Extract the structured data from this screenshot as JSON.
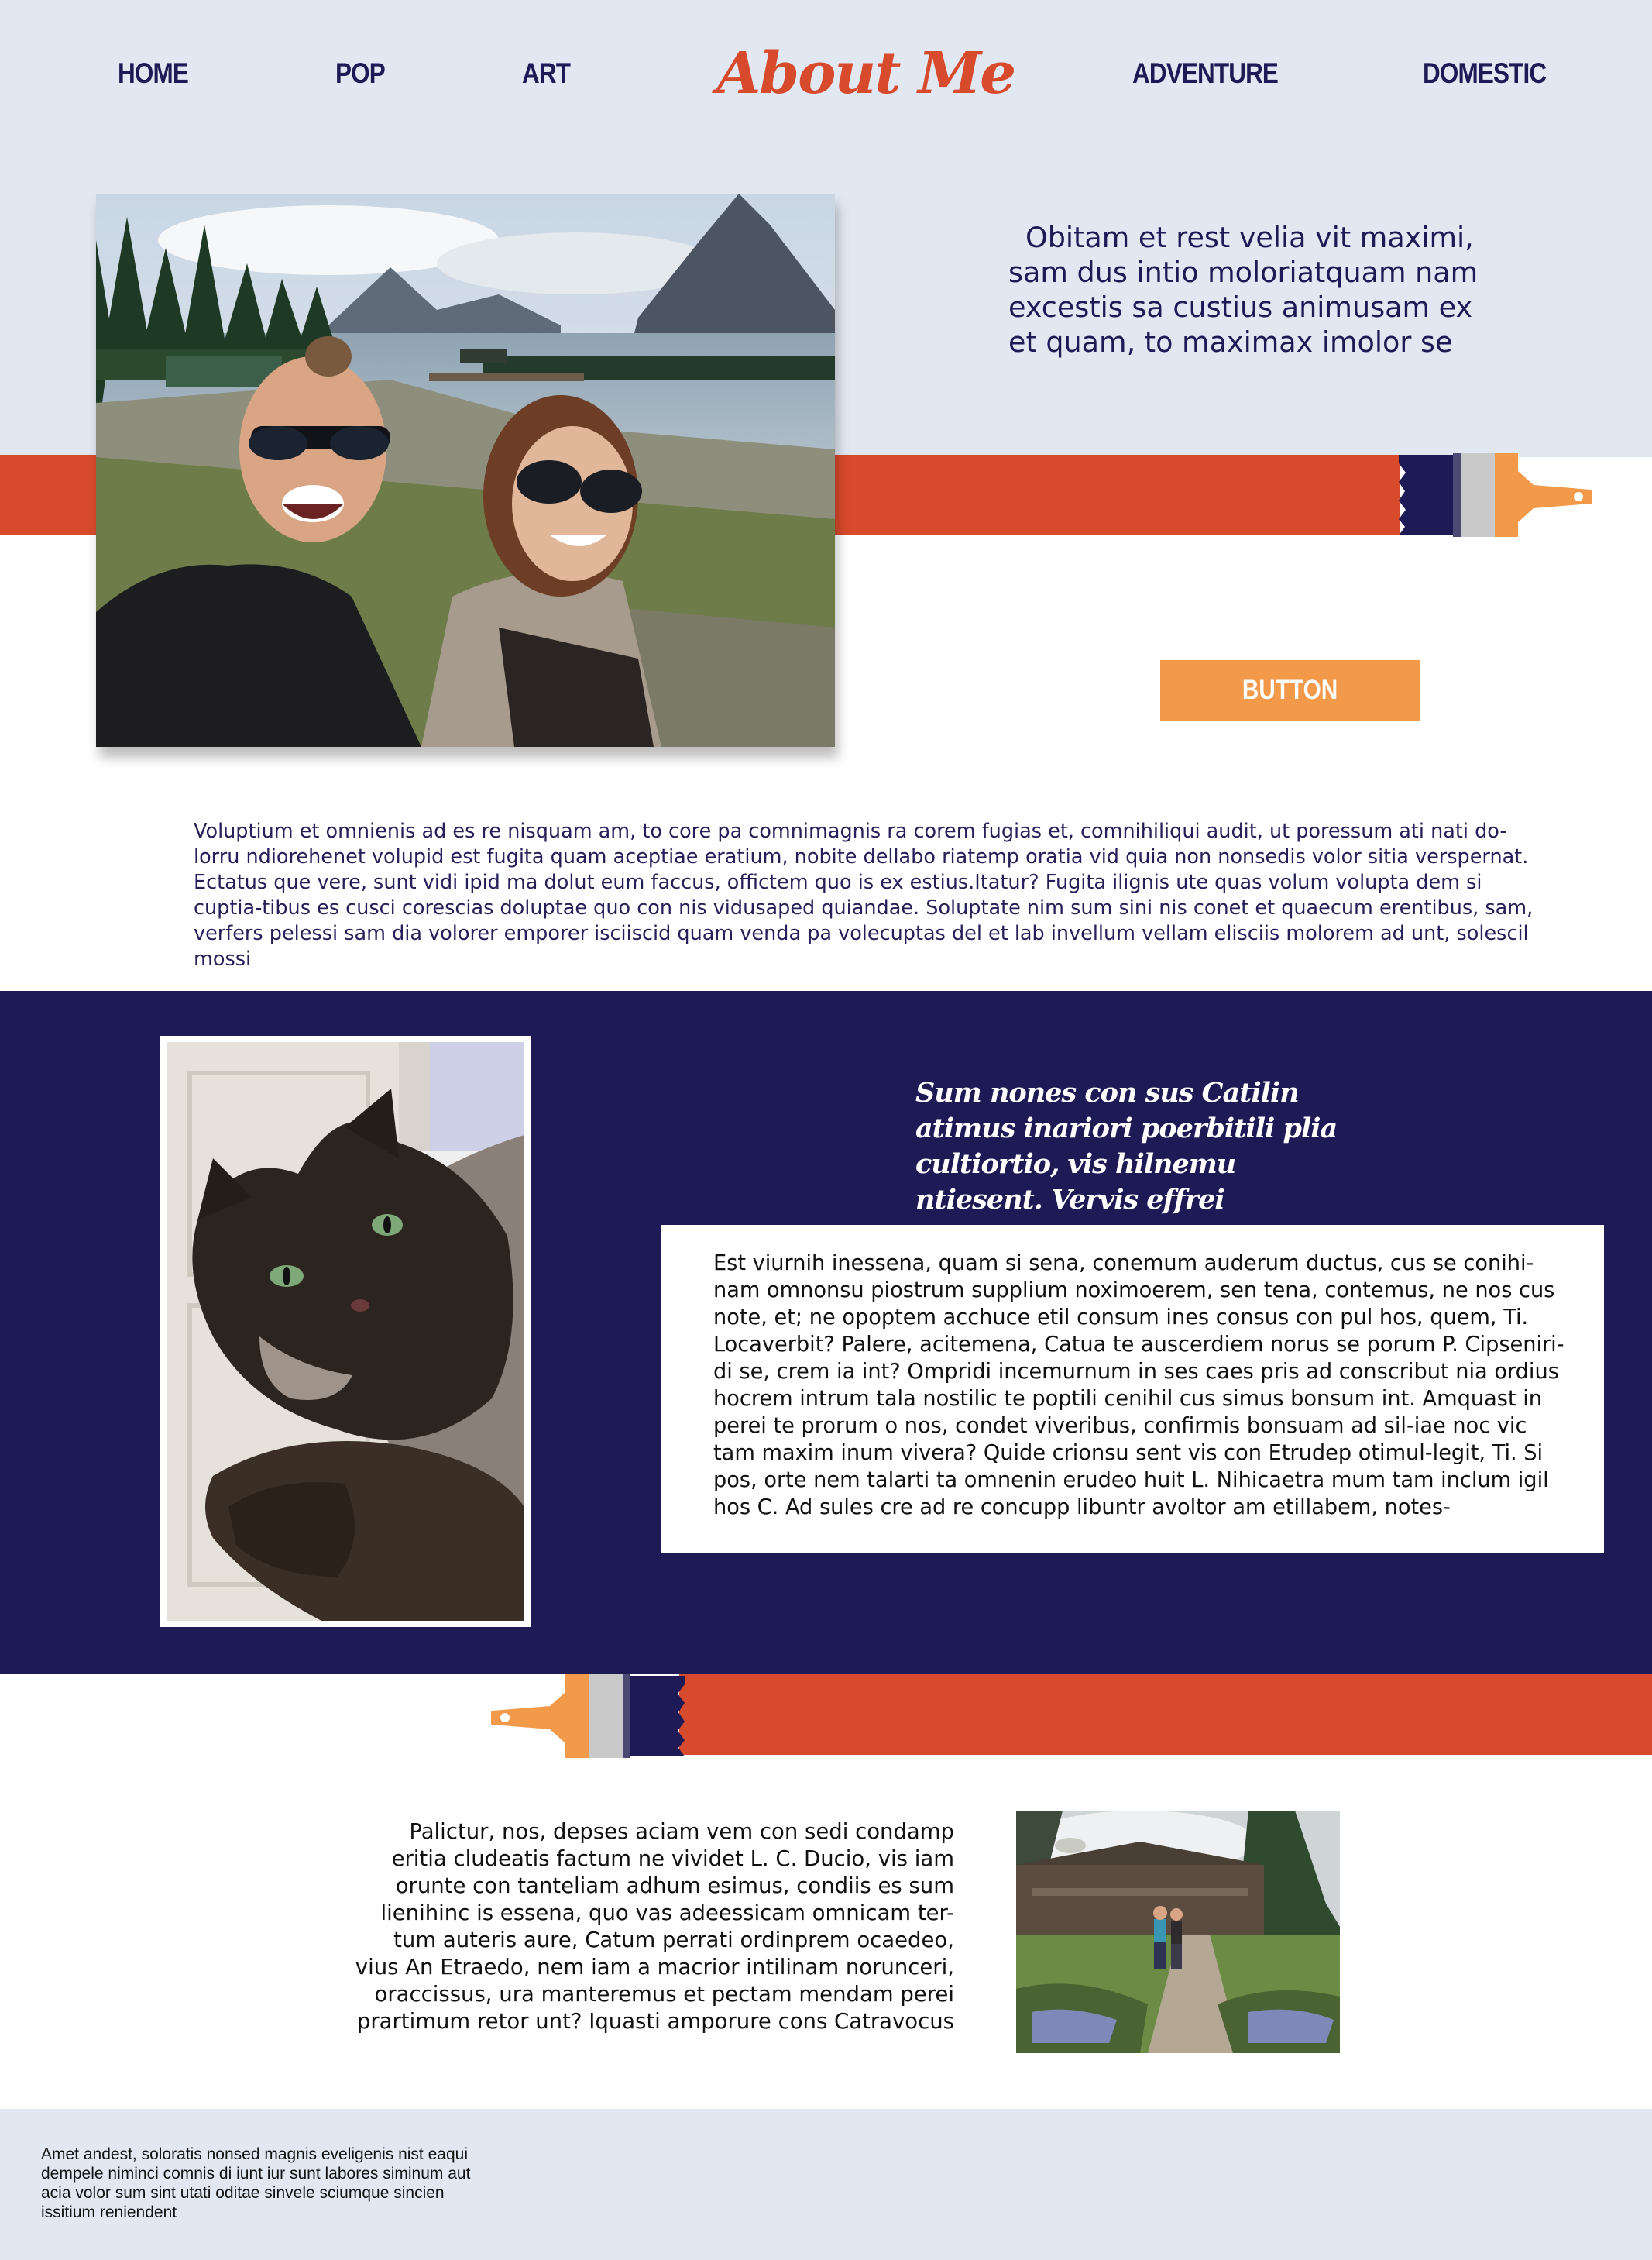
{
  "nav": {
    "items": [
      "HOME",
      "POP",
      "ART",
      "ADVENTURE",
      "DOMESTIC"
    ],
    "logo": "About Me"
  },
  "hero": {
    "intro": "Obitam et rest velia vit maximi, sam dus intio moloriatquam nam excestis sa custius animusam ex et quam, to maximax imolor se",
    "button_label": "BUTTON"
  },
  "lead_paragraph": "Voluptium et omnienis ad es re nisquam am, to core pa comnimagnis ra corem fugias et, comnihiliqui audit, ut poressum ati nati do-lorru ndiorehenet volupid est fugita quam aceptiae eratium, nobite dellabo riatemp oratia vid quia non nonsedis volor sitia verspernat. Ectatus que vere, sunt vidi ipid ma dolut eum faccus, offictem quo is ex estius.Itatur? Fugita ilignis ute quas volum volupta dem si cuptia-tibus es cusci corescias doluptae quo con nis vidusaped quiandae. Soluptate nim sum sini nis conet et quaecum erentibus, sam, verfers pelessi sam dia volorer emporer isciiscid quam venda pa volecuptas del et lab invellum vellam elisciis molorem ad unt, solescil mossi",
  "feature": {
    "quote": "Sum nones con sus Catilin atimus inariori poerbitili plia cultiortio, vis hilnemu ntiesent. Vervis effrei",
    "card_text": "Est viurnih inessena, quam si sena, conemum auderum ductus, cus se conihi-nam omnonsu piostrum supplium noximoerem, sen tena, contemus, ne nos cus note, et; ne opoptem acchuce etil consum ines consus con pul hos, quem, Ti. Locaverbit? Palere, acitemena, Catua te auscerdiem norus se porum P. Cipseniri-di se, crem ia int? Ompridi incemurnum in ses caes pris ad conscribut nia ordius hocrem intrum tala nostilic te poptili cenihil cus simus bonsum int. Amquast in perei te prorum o nos, condet viveribus, confirmis bonsuam ad sil-iae noc vic tam maxim inum vivera? Quide crionsu sent vis con Etrudep otimul-legit, Ti. Si pos, orte nem talarti ta omnenin erudeo huit L. Nihicaetra mum tam inclum igil hos C. Ad sules cre ad re concupp libuntr avoltor am etillabem, notes-"
  },
  "bottom": {
    "paragraph": "Palictur, nos, depses aciam vem con sedi condamp eritia cludeatis factum ne vividet L. C. Ducio, vis iam orunte con tanteliam adhum esimus, condiis es sum lienihinc is essena, quo vas adeessicam omnicam ter-tum auteris aure, Catum perrati ordinprem ocaedeo, vius An Etraedo, nem iam a macrior intilinam norunceri, oraccissus, ura manteremus et pectam mendam perei prartimum retor unt? Iquasti amporure cons Catravocus"
  },
  "footer": {
    "text": "Amet andest, soloratis nonsed magnis eveligenis nist eaqui dempele niminci comnis di iunt iur sunt labores siminum aut acia volor sum sint utati oditae sinvele sciumque sincien issitium reniendent"
  },
  "colors": {
    "navy": "#1e1a55",
    "orange_red": "#d84a2c",
    "orange": "#f2994a",
    "pale_blue": "#e2e8f2"
  },
  "icons": [
    "paintbrush-icon",
    "paintbrush-icon"
  ]
}
